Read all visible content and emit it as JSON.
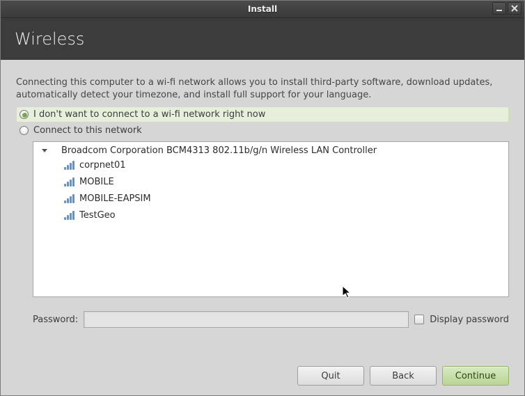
{
  "titlebar": {
    "title": "Install"
  },
  "header": {
    "title": "Wireless"
  },
  "intro": "Connecting this computer to a wi-fi network allows you to install third-party software, download updates, automatically detect your timezone, and install full support for your language.",
  "options": {
    "no_connect": "I don't want to connect to a wi-fi network right now",
    "connect": "Connect to this network",
    "selected": "no_connect"
  },
  "adapter": "Broadcom Corporation BCM4313 802.11b/g/n Wireless LAN Controller",
  "networks": [
    {
      "name": "corpnet01"
    },
    {
      "name": "MOBILE"
    },
    {
      "name": "MOBILE-EAPSIM"
    },
    {
      "name": "TestGeo"
    }
  ],
  "password": {
    "label": "Password:",
    "value": "",
    "display_label": "Display password",
    "disabled": true
  },
  "buttons": {
    "quit": "Quit",
    "back": "Back",
    "continue": "Continue"
  }
}
